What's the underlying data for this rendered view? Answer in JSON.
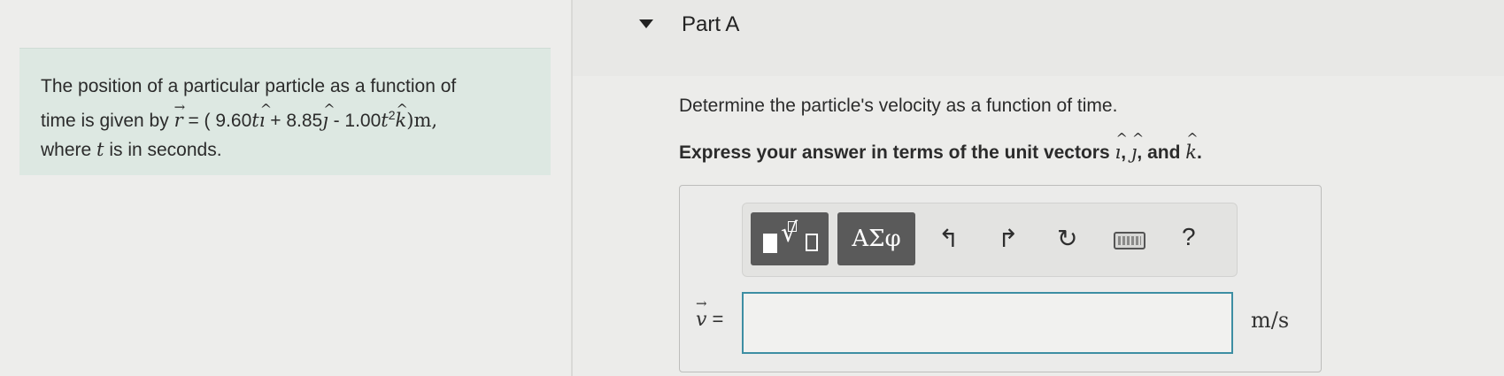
{
  "problem": {
    "line1": "The position of a particular particle as a function of",
    "line2_prefix": "time is given by ",
    "r_symbol": "r",
    "equals_open": " = ( 9.60",
    "t1": "t",
    "i_letter": "ı",
    "plus": " + 8.85",
    "j_letter": "ȷ",
    "minus": " - 1.00",
    "t2": "t",
    "sq": "2",
    "k_letter": "k",
    "close_m": ")m,",
    "line3_prefix": "where ",
    "t3": "t",
    "line3_suffix": " is in seconds."
  },
  "part": {
    "title": "Part A",
    "question": "Determine the particle's velocity as a function of time.",
    "instruction_prefix": "Express your answer in terms of the unit vectors ",
    "i": "ı",
    "sep1": ", ",
    "j": "ȷ",
    "sep2": ", and ",
    "k": "k",
    "period": "."
  },
  "toolbar": {
    "greek_label": "ΑΣφ",
    "undo_glyph": "↰",
    "redo_glyph": "↱",
    "reset_glyph": "↻",
    "help_label": "?"
  },
  "answer": {
    "variable": "v",
    "equals": " =",
    "value": "",
    "units": "m/s"
  },
  "icons": {
    "collapse": "triangle-down-icon",
    "templates": "templates-icon",
    "undo": "undo-icon",
    "redo": "redo-icon",
    "reset": "reset-icon",
    "keyboard": "keyboard-icon"
  }
}
